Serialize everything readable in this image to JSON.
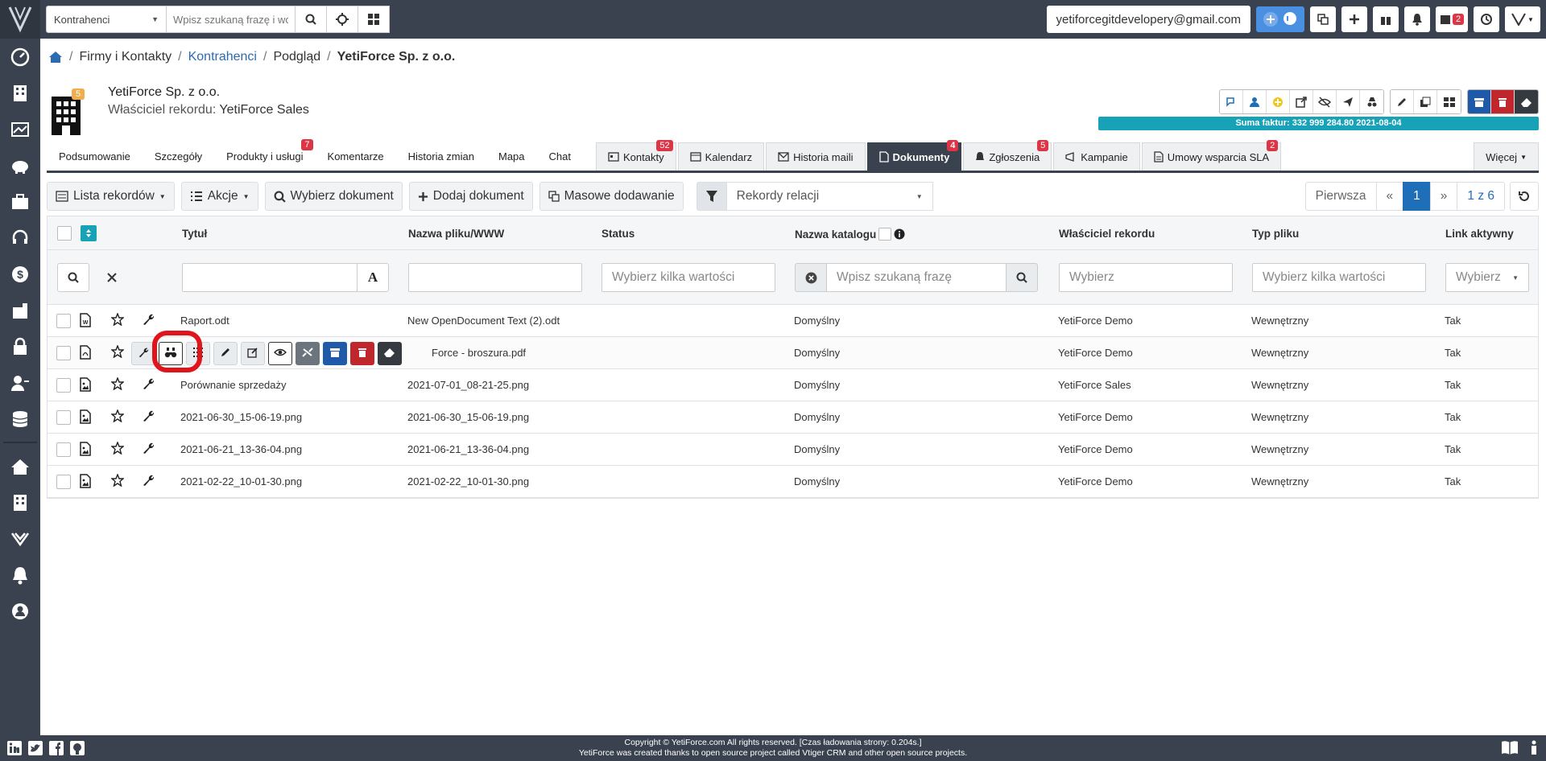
{
  "topbar": {
    "module_select": "Kontrahenci",
    "search_placeholder": "Wpisz szukaną frazę i wc",
    "email": "yetiforcegitdevelopery@gmail.com",
    "calendar_badge": "2"
  },
  "breadcrumb": {
    "level1": "Firmy i Kontakty",
    "level2": "Kontrahenci",
    "level3": "Podgląd",
    "current": "YetiForce Sp. z o.o."
  },
  "record": {
    "badge": "5",
    "title": "YetiForce Sp. z o.o.",
    "owner_label": "Właściciel rekordu:",
    "owner_value": "YetiForce Sales",
    "sum_bar": "Suma faktur: 332 999 284.80 2021-08-04"
  },
  "tabs": {
    "summary": "Podsumowanie",
    "details": "Szczegóły",
    "products": "Produkty i usługi",
    "products_count": "7",
    "comments": "Komentarze",
    "history": "Historia zmian",
    "map": "Mapa",
    "chat": "Chat",
    "contacts": "Kontakty",
    "contacts_count": "52",
    "calendar": "Kalendarz",
    "mail_history": "Historia maili",
    "documents": "Dokumenty",
    "documents_count": "4",
    "tickets": "Zgłoszenia",
    "tickets_count": "5",
    "campaigns": "Kampanie",
    "sla": "Umowy wsparcia SLA",
    "sla_count": "2",
    "more": "Więcej"
  },
  "toolbar": {
    "record_list": "Lista rekordów",
    "actions": "Akcje",
    "select_document": "Wybierz dokument",
    "add_document": "Dodaj dokument",
    "mass_add": "Masowe dodawanie",
    "relation_filter": "Rekordy relacji",
    "first": "Pierwsza",
    "prev": "«",
    "page": "1",
    "next": "»",
    "page_of": "1 z 6"
  },
  "columns": {
    "title": "Tytuł",
    "filename": "Nazwa pliku/WWW",
    "status": "Status",
    "folder": "Nazwa katalogu",
    "owner": "Właściciel rekordu",
    "filetype": "Typ pliku",
    "active_link": "Link aktywny"
  },
  "filters": {
    "status_placeholder": "Wybierz kilka wartości",
    "folder_placeholder": "Wpisz szukaną frazę",
    "owner_placeholder": "Wybierz",
    "filetype_placeholder": "Wybierz kilka wartości",
    "active_placeholder": "Wybierz"
  },
  "rows": [
    {
      "title": "Raport.odt",
      "filename": "New OpenDocument Text (2).odt",
      "folder": "Domyślny",
      "owner": "YetiForce Demo",
      "filetype": "Wewnętrzny",
      "active": "Tak",
      "icon": "word-file-icon"
    },
    {
      "title": "",
      "filename": "Force - broszura.pdf",
      "folder": "Domyślny",
      "owner": "YetiForce Demo",
      "filetype": "Wewnętrzny",
      "active": "Tak",
      "icon": "pdf-file-icon"
    },
    {
      "title": "Porównanie sprzedaży",
      "filename": "2021-07-01_08-21-25.png",
      "folder": "Domyślny",
      "owner": "YetiForce Sales",
      "filetype": "Wewnętrzny",
      "active": "Tak",
      "icon": "image-file-icon"
    },
    {
      "title": "2021-06-30_15-06-19.png",
      "filename": "2021-06-30_15-06-19.png",
      "folder": "Domyślny",
      "owner": "YetiForce Demo",
      "filetype": "Wewnętrzny",
      "active": "Tak",
      "icon": "image-file-icon"
    },
    {
      "title": "2021-06-21_13-36-04.png",
      "filename": "2021-06-21_13-36-04.png",
      "folder": "Domyślny",
      "owner": "YetiForce Demo",
      "filetype": "Wewnętrzny",
      "active": "Tak",
      "icon": "image-file-icon"
    },
    {
      "title": "2021-02-22_10-01-30.png",
      "filename": "2021-02-22_10-01-30.png",
      "folder": "Domyślny",
      "owner": "YetiForce Demo",
      "filetype": "Wewnętrzny",
      "active": "Tak",
      "icon": "image-file-icon"
    }
  ],
  "footer": {
    "line1": "Copyright © YetiForce.com All rights reserved. [Czas ładowania strony: 0.204s.]",
    "line2": "YetiForce was created thanks to open source project called Vtiger CRM and other open source projects."
  },
  "colors": {
    "dark": "#39424e",
    "accent_blue": "#1e6fb8",
    "teal": "#17a2b8",
    "danger": "#dc3545",
    "highlight_ring": "#e0141b"
  }
}
